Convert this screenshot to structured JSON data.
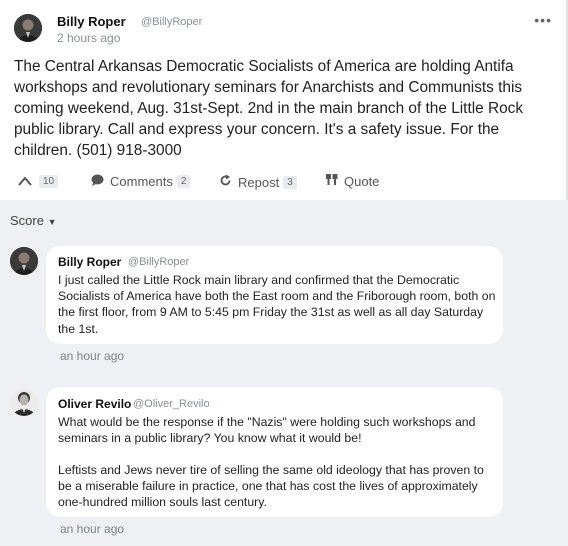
{
  "post": {
    "author": "Billy Roper",
    "handle": "@BillyRoper",
    "time": "2 hours ago",
    "more_icon": "more-dots-icon",
    "text": "The Central Arkansas Democratic Socialists of America are holding Antifa workshops and revolutionary seminars for Anarchists and Communists this coming weekend, Aug. 31st-Sept. 2nd in the main branch of the Little Rock public library. Call and express your concern. It's a safety issue. For the children. (501) 918-3000",
    "upvote_count": "10",
    "comments_label": "Comments",
    "comments_count": "2",
    "repost_label": "Repost",
    "repost_count": "3",
    "quote_label": "Quote"
  },
  "sort": {
    "label": "Score"
  },
  "comments": [
    {
      "author": "Billy Roper",
      "handle": "@BillyRoper",
      "text": "I just called the Little Rock main library and confirmed that the Democratic Socialists of America have both the East room and the Friborough room, both on the first floor, from 9 AM to 5:45 pm Friday the 31st as well as all day Saturday the 1st.",
      "time": "an hour ago"
    },
    {
      "author": "Oliver Revilo",
      "handle": "@Oliver_Revilo",
      "text_p1": "What would be the response if the \"Nazis\" were holding such workshops and seminars in a public library? You know what it would be!",
      "text_p2": "Leftists and Jews never tire of selling the same old ideology that has proven to be a miserable failure in practice, one that has cost the lives of approximately one-hundred million souls last century.",
      "time": "an hour ago"
    }
  ]
}
